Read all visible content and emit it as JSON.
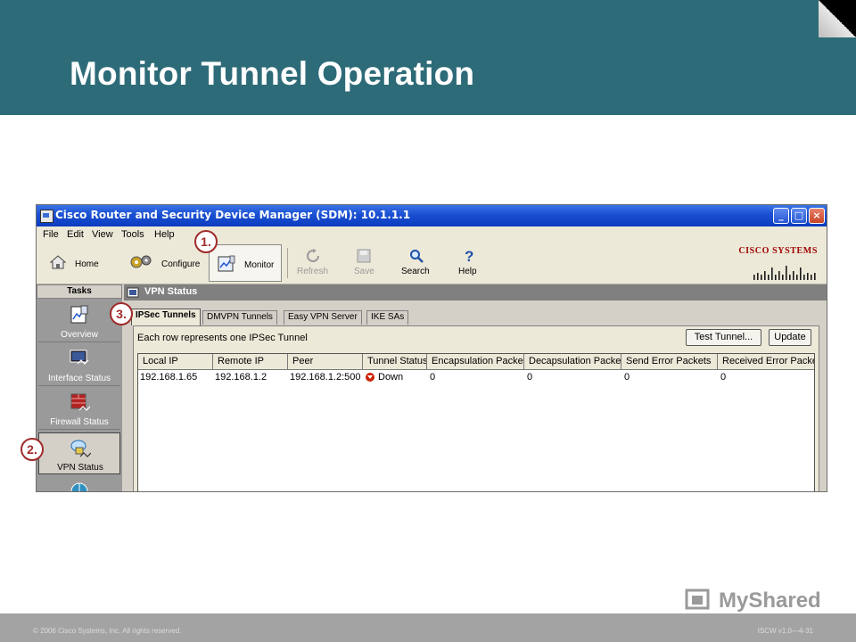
{
  "slide": {
    "title": "Monitor Tunnel Operation",
    "footer_copyright": "© 2006 Cisco Systems, Inc. All rights reserved.",
    "footer_code": "ISCW v1.0—4-31",
    "watermark_text": "MyShared"
  },
  "window": {
    "title": "Cisco Router and Security Device Manager (SDM): 10.1.1.1"
  },
  "menu": [
    "File",
    "Edit",
    "View",
    "Tools",
    "Help"
  ],
  "toolbar": {
    "home": "Home",
    "configure": "Configure",
    "monitor": "Monitor",
    "refresh": "Refresh",
    "save": "Save",
    "search": "Search",
    "help": "Help"
  },
  "brand": {
    "name": "Cisco Systems"
  },
  "tasks": {
    "header": "Tasks",
    "items": [
      "Overview",
      "Interface Status",
      "Firewall Status",
      "VPN Status"
    ]
  },
  "vpn": {
    "header": "VPN Status",
    "tabs": [
      "IPSec Tunnels",
      "DMVPN Tunnels",
      "Easy VPN Server",
      "IKE SAs"
    ],
    "info": "Each row represents one IPSec Tunnel",
    "test_tunnel_btn": "Test Tunnel...",
    "update_btn": "Update",
    "columns": [
      "Local IP",
      "Remote IP",
      "Peer",
      "Tunnel Status",
      "Encapsulation Packets",
      "Decapsulation Packets",
      "Send Error Packets",
      "Received Error Packets"
    ],
    "rows": [
      {
        "local_ip": "192.168.1.65",
        "remote_ip": "192.168.1.2",
        "peer": "192.168.1.2:500",
        "status": "Down",
        "encap": "0",
        "decap": "0",
        "send_err": "0",
        "recv_err": "0"
      }
    ]
  },
  "callouts": [
    "1.",
    "2.",
    "3."
  ],
  "colors": {
    "header_teal": "#2e6b78",
    "callout_red": "#a02a2a",
    "titlebar_blue": "#1a4fd1",
    "status_down": "#cc2200"
  }
}
